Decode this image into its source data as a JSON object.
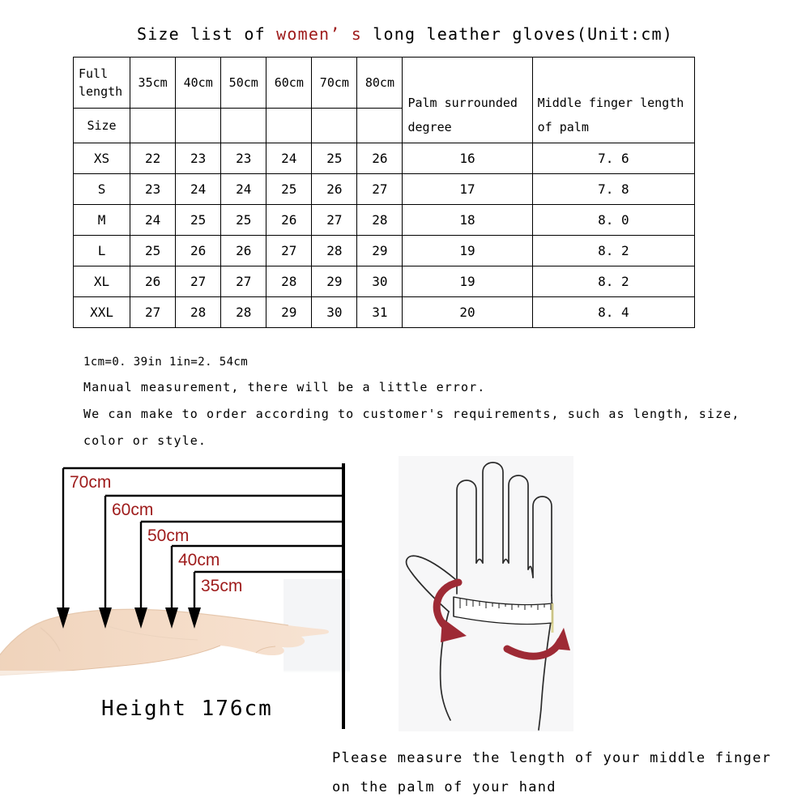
{
  "title": {
    "before": "Size list of ",
    "accent": "women’ s",
    "after": " long leather gloves(Unit:cm)"
  },
  "table": {
    "corner_line1": "Full",
    "corner_line2": "length",
    "corner_line3": "Size",
    "length_headers": [
      "35cm",
      "40cm",
      "50cm",
      "60cm",
      "70cm",
      "80cm"
    ],
    "palm_header_line1": "Palm surrounded",
    "palm_header_line2": "degree",
    "middle_header_line1": "Middle finger length",
    "middle_header_line2": "of palm",
    "rows": [
      {
        "size": "XS",
        "lengths": [
          "22",
          "23",
          "23",
          "24",
          "25",
          "26"
        ],
        "palm": "16",
        "middle": "7. 6"
      },
      {
        "size": "S",
        "lengths": [
          "23",
          "24",
          "24",
          "25",
          "26",
          "27"
        ],
        "palm": "17",
        "middle": "7. 8"
      },
      {
        "size": "M",
        "lengths": [
          "24",
          "25",
          "25",
          "26",
          "27",
          "28"
        ],
        "palm": "18",
        "middle": "8. 0"
      },
      {
        "size": "L",
        "lengths": [
          "25",
          "26",
          "26",
          "27",
          "28",
          "29"
        ],
        "palm": "19",
        "middle": "8. 2"
      },
      {
        "size": "XL",
        "lengths": [
          "26",
          "27",
          "27",
          "28",
          "29",
          "30"
        ],
        "palm": "19",
        "middle": "8. 2"
      },
      {
        "size": "XXL",
        "lengths": [
          "27",
          "28",
          "28",
          "29",
          "30",
          "31"
        ],
        "palm": "20",
        "middle": "8. 4"
      }
    ]
  },
  "notes": [
    "1cm=0. 39in  1in=2. 54cm",
    "Manual measurement, there will be a little error.",
    "We can make to order according to customer's requirements, such as length, size,",
    "color or style."
  ],
  "arm_figure": {
    "measurements": [
      "70cm",
      "60cm",
      "50cm",
      "40cm",
      "35cm"
    ],
    "height_label": "Height 176cm"
  },
  "instruction": [
    "Please measure the length of your middle finger",
    "on the palm of your hand"
  ],
  "colors": {
    "accent_red": "#9e1b1b",
    "arrow_red": "#9e2a35",
    "line_black": "#000000",
    "skin": "#f5ddc9"
  },
  "chart_data": {
    "type": "table",
    "title": "Size list of women’s long leather gloves (Unit:cm)",
    "columns": [
      "Size",
      "35cm",
      "40cm",
      "50cm",
      "60cm",
      "70cm",
      "80cm",
      "Palm surrounded degree",
      "Middle finger length of palm"
    ],
    "rows": [
      [
        "XS",
        22,
        23,
        23,
        24,
        25,
        26,
        16,
        7.6
      ],
      [
        "S",
        23,
        24,
        24,
        25,
        26,
        27,
        17,
        7.8
      ],
      [
        "M",
        24,
        25,
        25,
        26,
        27,
        28,
        18,
        8.0
      ],
      [
        "L",
        25,
        26,
        26,
        27,
        28,
        29,
        19,
        8.2
      ],
      [
        "XL",
        26,
        27,
        27,
        28,
        29,
        30,
        19,
        8.2
      ],
      [
        "XXL",
        27,
        28,
        28,
        29,
        30,
        31,
        20,
        8.4
      ]
    ]
  }
}
